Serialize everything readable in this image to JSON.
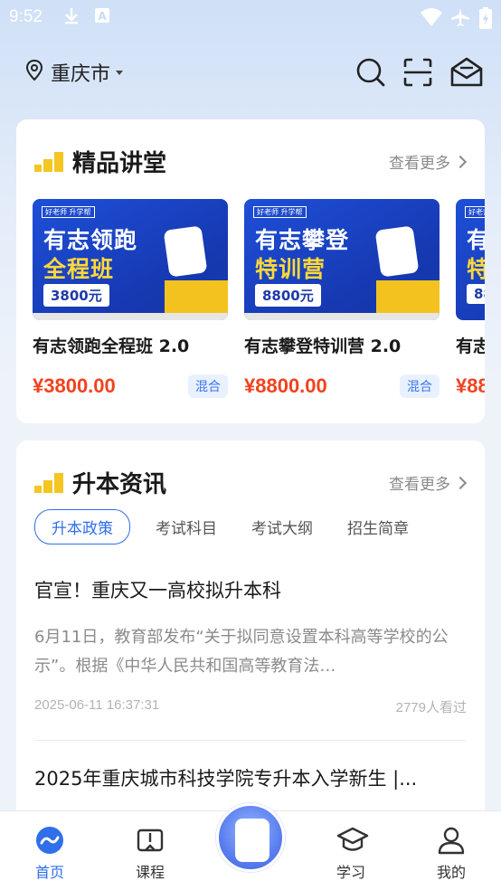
{
  "status_bar": {
    "time": "9:52"
  },
  "header": {
    "city": "重庆市"
  },
  "featured": {
    "title": "精品讲堂",
    "more_label": "查看更多",
    "courses": [
      {
        "poster_tag": "好老师 升学帮",
        "poster_line1": "有志领跑",
        "poster_line2": "全程班",
        "poster_price": "3800元",
        "name": "有志领跑全程班 2.0",
        "price": "¥3800.00",
        "badge": "混合"
      },
      {
        "poster_tag": "好老师 升学帮",
        "poster_line1": "有志攀登",
        "poster_line2": "特训营",
        "poster_price": "8800元",
        "name": "有志攀登特训营 2.0",
        "price": "¥8800.00",
        "badge": "混合"
      },
      {
        "poster_tag": "好老师 升学帮",
        "poster_line1": "有",
        "poster_line2": "特",
        "poster_price": "88",
        "name": "有志",
        "price": "¥88",
        "badge": ""
      }
    ]
  },
  "news_section": {
    "title": "升本资讯",
    "more_label": "查看更多",
    "tabs": [
      "升本政策",
      "考试科目",
      "考试大纲",
      "招生简章"
    ],
    "items": [
      {
        "title": "官宣！重庆又一高校拟升本科",
        "summary": "6月11日，教育部发布“关于拟同意设置本科高等学校的公示”。根据《中华人民共和国高等教育法…",
        "time": "2025-06-11 16:37:31",
        "views": "2779人看过"
      },
      {
        "title": "2025年重庆城市科技学院专升本入学新生 |...",
        "summary": "",
        "time": "",
        "views": ""
      }
    ]
  },
  "bottom_nav": {
    "items": [
      {
        "label": "首页",
        "icon": "home-icon"
      },
      {
        "label": "课程",
        "icon": "book-icon"
      },
      {
        "label": "学习",
        "icon": "graduation-cap-icon"
      },
      {
        "label": "我的",
        "icon": "user-icon"
      }
    ]
  },
  "colors": {
    "accent": "#2f6fea",
    "price": "#f1421e",
    "brand_yellow": "#f3c623",
    "poster_blue": "#1e4fd8"
  }
}
